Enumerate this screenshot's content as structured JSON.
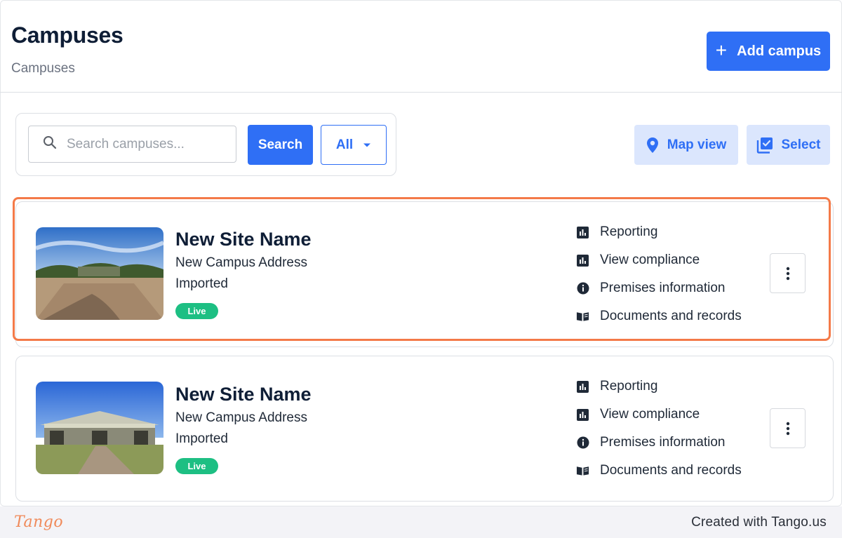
{
  "header": {
    "title": "Campuses",
    "breadcrumb": "Campuses",
    "add_button_label": "Add campus"
  },
  "toolbar": {
    "search_placeholder": "Search campuses...",
    "search_value": "",
    "search_button_label": "Search",
    "filter_selected": "All",
    "map_view_label": "Map view",
    "select_label": "Select"
  },
  "campuses": [
    {
      "name": "New Site Name",
      "address": "New Campus Address",
      "status": "Imported",
      "badge": "Live",
      "actions": [
        "Reporting",
        "View compliance",
        "Premises information",
        "Documents and records"
      ],
      "highlighted": true
    },
    {
      "name": "New Site Name",
      "address": "New Campus Address",
      "status": "Imported",
      "badge": "Live",
      "actions": [
        "Reporting",
        "View compliance",
        "Premises information",
        "Documents and records"
      ],
      "highlighted": false
    }
  ],
  "action_icons": [
    "bar-chart-icon",
    "bar-chart-icon",
    "info-icon",
    "book-icon"
  ],
  "footer": {
    "logo_text": "Tango",
    "credit": "Created with Tango.us"
  },
  "colors": {
    "primary": "#2f6ff5",
    "primary_soft": "#dbe6fd",
    "badge_live": "#1dbf83",
    "highlight": "#f47a48",
    "text_dark": "#0f1e36"
  }
}
